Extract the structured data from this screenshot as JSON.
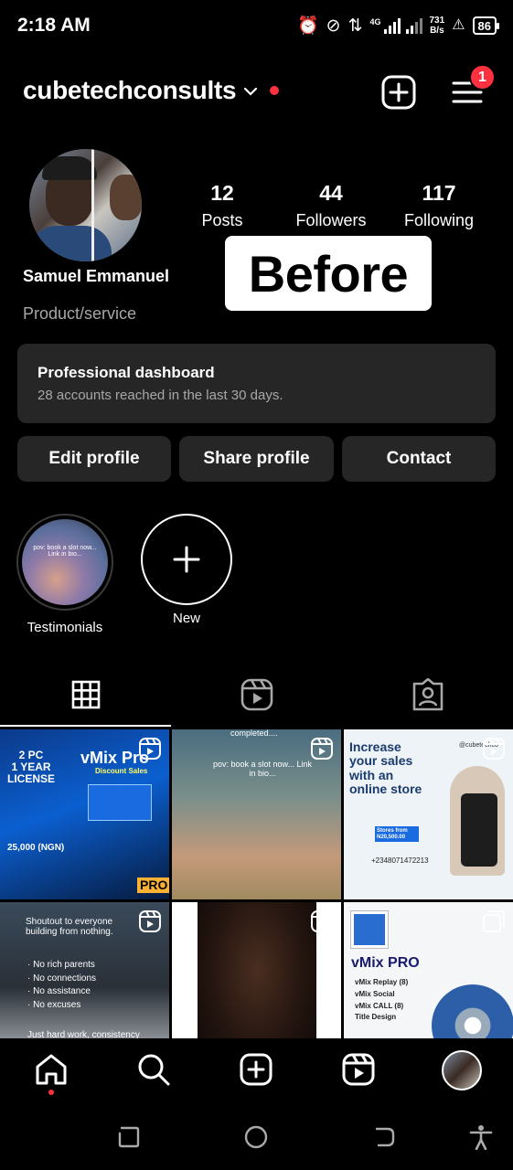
{
  "status_bar": {
    "time": "2:18 AM",
    "network": "4G",
    "net_speed_value": "731",
    "net_speed_unit": "B/s",
    "battery": "86"
  },
  "header": {
    "username": "cubetechconsults",
    "notification_count": "1"
  },
  "profile": {
    "full_name": "Samuel Emmanuel",
    "category": "Product/service",
    "stats": [
      {
        "value": "12",
        "label": "Posts"
      },
      {
        "value": "44",
        "label": "Followers"
      },
      {
        "value": "117",
        "label": "Following"
      }
    ],
    "overlay_label": "Before"
  },
  "dashboard": {
    "title": "Professional dashboard",
    "subtitle": "28 accounts reached in the last 30 days."
  },
  "buttons": {
    "edit": "Edit profile",
    "share": "Share profile",
    "contact": "Contact"
  },
  "highlights": [
    {
      "label": "Testimonials",
      "caption": "pov: book a slot now... Link in bio..."
    },
    {
      "label": "New"
    }
  ],
  "grid": {
    "posts": [
      {
        "lines": [
          "2 PC",
          "1 YEAR",
          "LICENSE"
        ],
        "brand": "vMix Pro",
        "sub": "Discount Sales",
        "tag": "PRO",
        "price": "25,000 (NGN)"
      },
      {
        "top": "completed....",
        "caption": "pov: book a slot now... Link in bio..."
      },
      {
        "lines": [
          "Increase",
          "your sales",
          "with an",
          "online store"
        ],
        "handle": "@cubetechco",
        "store": "Stores from N20,500.00",
        "phone": "+2348071472213"
      },
      {
        "lines": [
          "Shoutout to everyone",
          "building from nothing."
        ],
        "bullets": [
          "· No rich parents",
          "· No connections",
          "· No assistance",
          "· No excuses"
        ],
        "footer": "Just hard work, consistency"
      },
      {},
      {
        "brand": "vMix PRO",
        "items": [
          "vMix Replay (8)",
          "vMix Social",
          "vMix CALL (8)",
          "Title Design"
        ]
      }
    ]
  },
  "colors": {
    "accent_red": "#ff3040",
    "card_bg": "#262626",
    "muted_text": "#a8a8a8"
  }
}
